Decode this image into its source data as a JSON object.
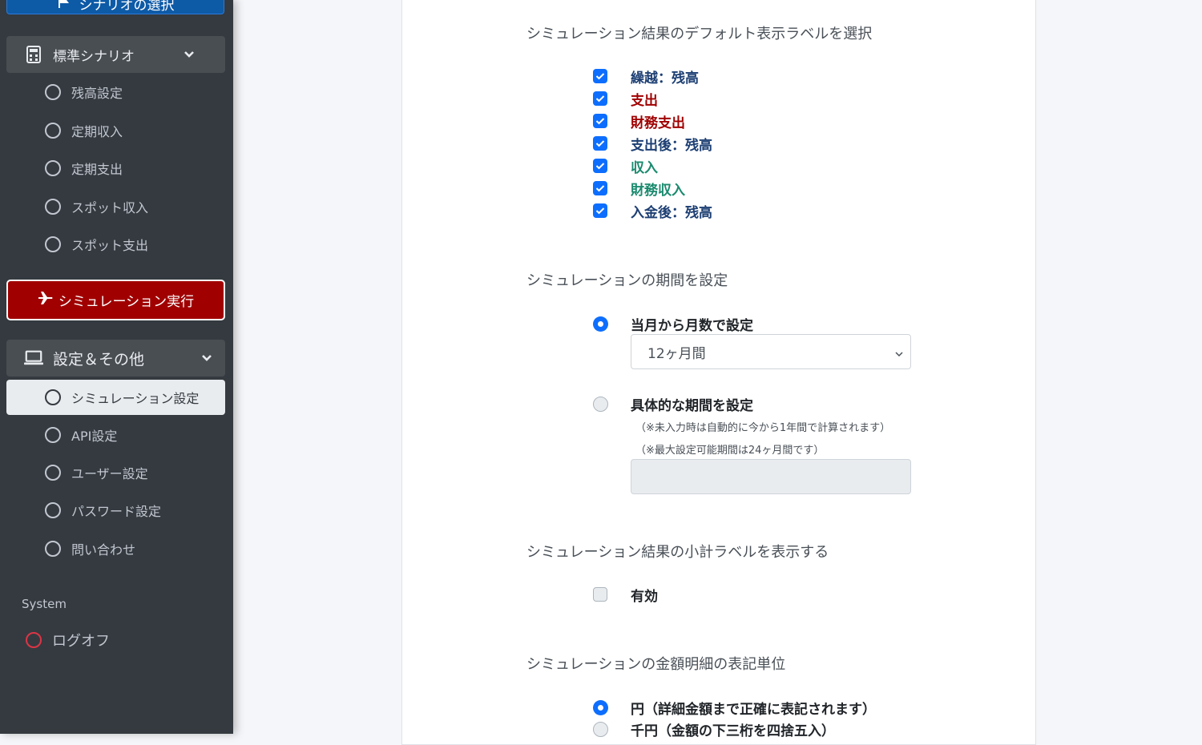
{
  "sidebar": {
    "top_button_label": "シナリオの選択",
    "standard_group": {
      "label": "標準シナリオ",
      "items": [
        {
          "label": "残高設定"
        },
        {
          "label": "定期収入"
        },
        {
          "label": "定期支出"
        },
        {
          "label": "スポット収入"
        },
        {
          "label": "スポット支出"
        }
      ]
    },
    "run_button_label": "シミュレーション実行",
    "settings_group": {
      "label": "設定＆その他",
      "items": [
        {
          "label": "シミュレーション設定",
          "active": true
        },
        {
          "label": "API設定"
        },
        {
          "label": "ユーザー設定"
        },
        {
          "label": "パスワード設定"
        },
        {
          "label": "問い合わせ"
        }
      ]
    },
    "system_header": "System",
    "logoff_label": "ログオフ"
  },
  "main": {
    "labels_section": {
      "title": "シミュレーション結果のデフォルト表示ラベルを選択",
      "options": [
        {
          "label": "繰越：残高",
          "checked": true,
          "color": "#1d3f73"
        },
        {
          "label": "支出",
          "checked": true,
          "color": "#a00000"
        },
        {
          "label": "財務支出",
          "checked": true,
          "color": "#a00000"
        },
        {
          "label": "支出後：残高",
          "checked": true,
          "color": "#1d3f73"
        },
        {
          "label": "収入",
          "checked": true,
          "color": "#1a8a6e"
        },
        {
          "label": "財務収入",
          "checked": true,
          "color": "#1a8a6e"
        },
        {
          "label": "入金後：残高",
          "checked": true,
          "color": "#1d3f73"
        }
      ]
    },
    "period_section": {
      "title": "シミュレーションの期間を設定",
      "option_months": "当月から月数で設定",
      "months_selected": "12ヶ月間",
      "option_specific": "具体的な期間を設定",
      "note1": "（※未入力時は自動的に今から1年間で計算されます）",
      "note2": "（※最大設定可能期間は24ヶ月間です）",
      "specific_value": ""
    },
    "subtotal_section": {
      "title": "シミュレーション結果の小計ラベルを表示する",
      "option_label": "有効",
      "checked": false
    },
    "unit_section": {
      "title": "シミュレーションの金額明細の表記単位",
      "option_yen": "円（詳細金額まで正確に表記されます）",
      "option_thousand": "千円（金額の下三桁を四捨五入）"
    }
  },
  "colors": {
    "accent": "#0d6efd",
    "run_button": "#a00000",
    "sidebar_bg": "#343a40"
  }
}
